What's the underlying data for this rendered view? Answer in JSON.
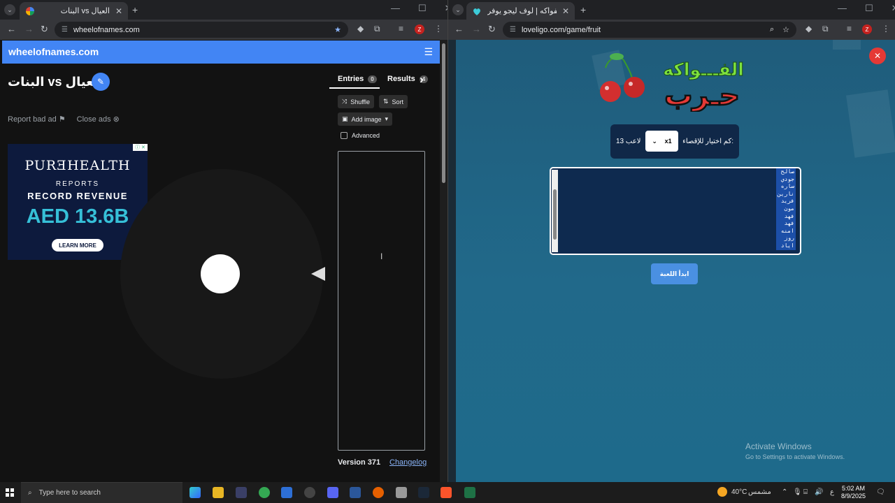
{
  "left_browser": {
    "tab_title": "البنات vs العيال",
    "url": "wheelofnames.com",
    "site_logo": "wheelofnames.com",
    "wheel_title": "البنات vs العيال",
    "report_bad_ad": "Report bad ad",
    "close_ads": "Close ads",
    "ad": {
      "brand": "PURƎHEALTH",
      "line1": "REPORTS",
      "line2": "RECORD REVENUE",
      "line3": "AED 13.6B",
      "cta": "LEARN MORE"
    },
    "panel": {
      "entries_label": "Entries",
      "entries_count": "0",
      "results_label": "Results",
      "results_count": "4",
      "shuffle": "Shuffle",
      "sort": "Sort",
      "add_image": "Add image",
      "advanced": "Advanced"
    },
    "version": "Version 371",
    "changelog": "Changelog"
  },
  "right_browser": {
    "tab_title": "لعبة حرب الفواكه | لوف ليجو يوفر",
    "url": "loveligo.com/game/fruit",
    "logo_top": "الفـــواكه",
    "logo_bottom": "حـرب",
    "elimination_label": "كم اختيار للإقصاء:",
    "elimination_value": "x1",
    "player_count": "13 لاعب",
    "names": [
      "صالح",
      "جودي",
      "ساره",
      "نارين",
      "فريد",
      "مون",
      "فهد",
      "فهد",
      "امنه",
      "روز",
      "اياد"
    ],
    "start_button": "ابدأ اللعبة",
    "activate_title": "Activate Windows",
    "activate_sub": "Go to Settings to activate Windows."
  },
  "taskbar": {
    "search_placeholder": "Type here to search",
    "weather": "40°C",
    "weather_label": "مشمس",
    "lang": "ع",
    "time": "5:02 AM",
    "date": "8/9/2025"
  },
  "colors": {
    "wheel_brand_blue": "#4285f4",
    "fruit_bg": "#1f5e7e",
    "close_red": "#e53935",
    "start_btn": "#4a90e2"
  }
}
